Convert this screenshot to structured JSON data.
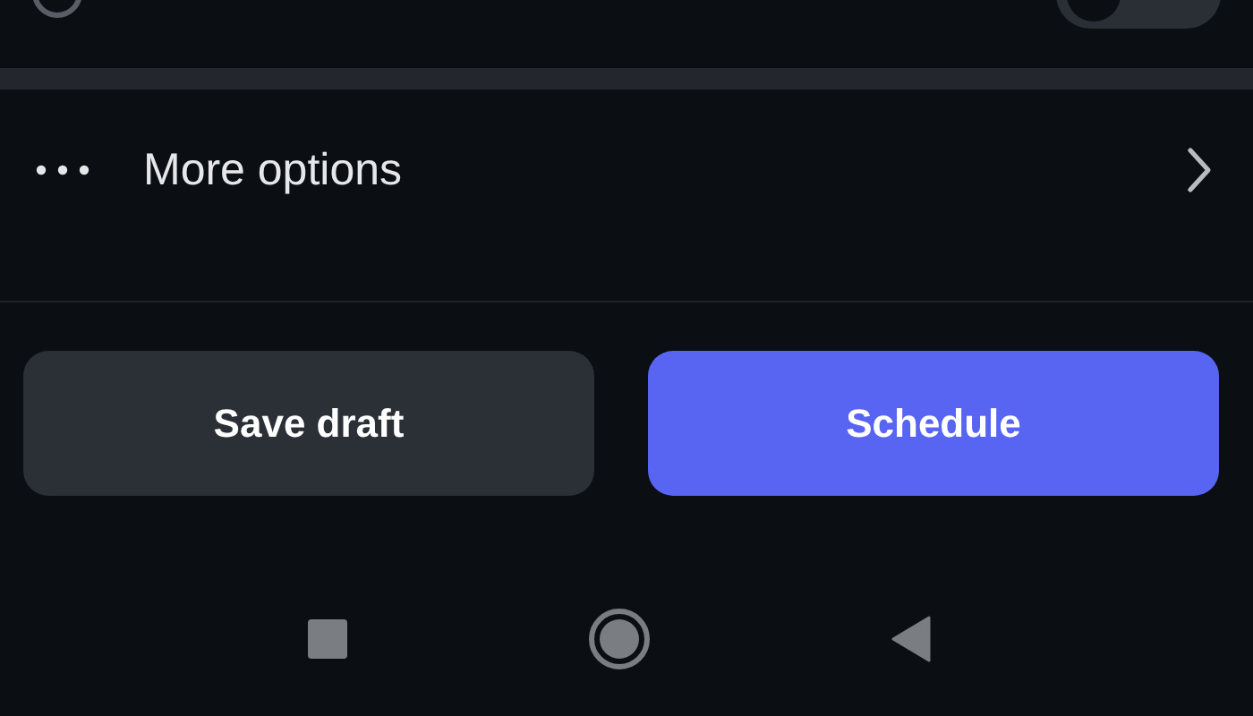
{
  "top_row": {
    "toggle": {
      "on": false
    }
  },
  "more_options": {
    "label": "More options"
  },
  "buttons": [
    {
      "label": "Save draft",
      "kind": "secondary"
    },
    {
      "label": "Schedule",
      "kind": "primary"
    }
  ]
}
